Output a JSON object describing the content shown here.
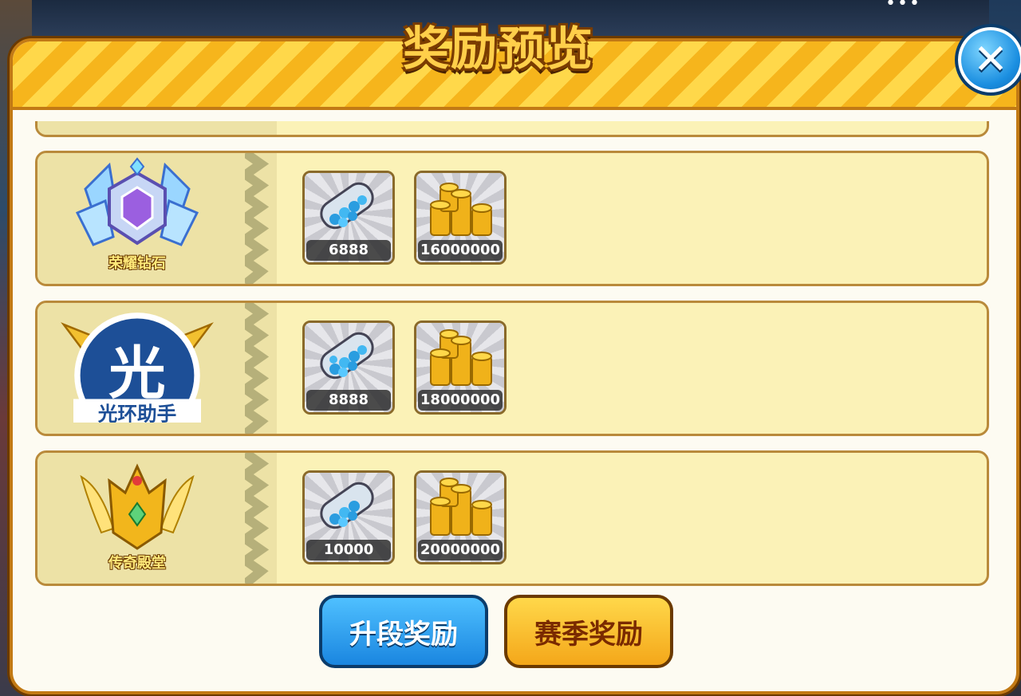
{
  "dialog": {
    "title": "奖励预览",
    "close_icon": "close-icon"
  },
  "status_bar": {
    "dots": "•••"
  },
  "ranks": [
    {
      "name": "荣耀钻石",
      "badge_icon": "diamond-crest-badge",
      "rewards": [
        {
          "icon": "gem-bottle-icon",
          "amount": "6888"
        },
        {
          "icon": "gold-coins-icon",
          "amount": "16000000"
        }
      ]
    },
    {
      "name": "光环助手",
      "badge_icon": "halo-assistant-watermark",
      "rewards": [
        {
          "icon": "gem-bottle-icon",
          "amount": "8888"
        },
        {
          "icon": "gold-coins-icon",
          "amount": "18000000"
        }
      ]
    },
    {
      "name": "传奇殿堂",
      "badge_icon": "legend-hall-badge",
      "rewards": [
        {
          "icon": "gem-bottle-icon",
          "amount": "10000"
        },
        {
          "icon": "gold-coins-icon",
          "amount": "20000000"
        }
      ]
    }
  ],
  "buttons": {
    "promotion_rewards": "升段奖励",
    "season_rewards": "赛季奖励"
  },
  "colors": {
    "accent_blue": "#1a86e0",
    "accent_gold": "#f4a71a",
    "row_bg": "#fbf2b7"
  }
}
